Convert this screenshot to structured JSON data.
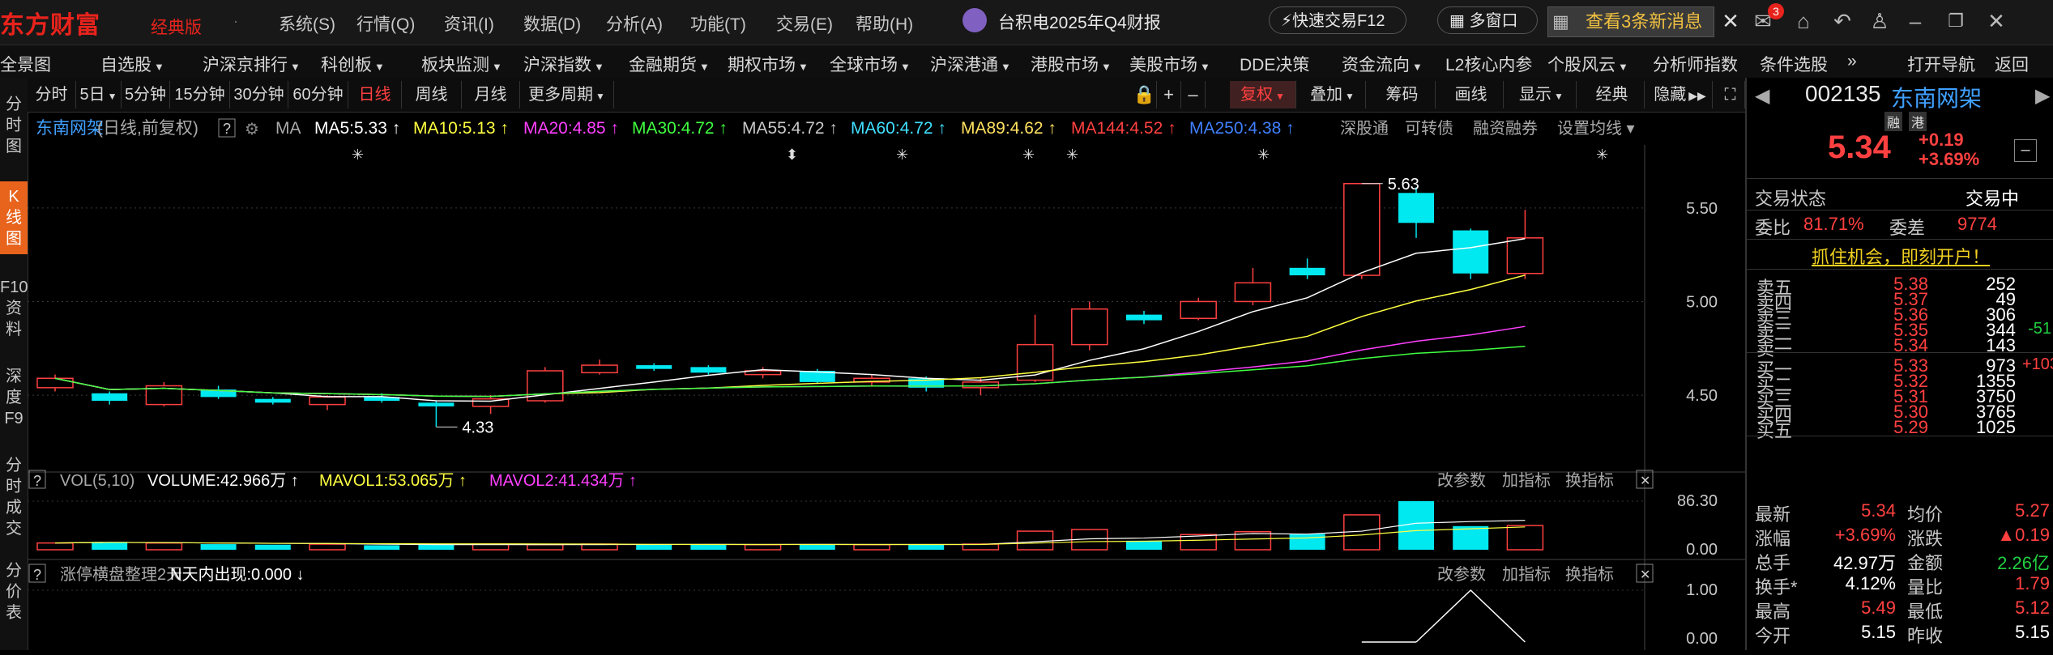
{
  "app": {
    "logo": "东方财富",
    "logo_sub": "经典版",
    "menus": [
      "系统(S)",
      "行情(Q)",
      "资讯(I)",
      "数据(D)",
      "分析(A)",
      "功能(T)",
      "交易(E)",
      "帮助(H)"
    ],
    "notice": "台积电2025年Q4财报",
    "quick_trade": "快速交易F12",
    "multi_window": "多窗口",
    "news_btn": "查看3条新消息",
    "mail_badge": "3"
  },
  "nav": {
    "items": [
      {
        "label": "全景图",
        "dd": false
      },
      {
        "label": "自选股",
        "dd": true
      },
      {
        "label": "沪深京排行",
        "dd": true
      },
      {
        "label": "科创板",
        "dd": true
      },
      {
        "label": "板块监测",
        "dd": true
      },
      {
        "label": "沪深指数",
        "dd": true
      },
      {
        "label": "金融期货",
        "dd": true
      },
      {
        "label": "期权市场",
        "dd": true
      },
      {
        "label": "全球市场",
        "dd": true
      },
      {
        "label": "沪深港通",
        "dd": true
      },
      {
        "label": "港股市场",
        "dd": true
      },
      {
        "label": "美股市场",
        "dd": true
      },
      {
        "label": "DDE决策",
        "dd": false
      },
      {
        "label": "资金流向",
        "dd": true
      },
      {
        "label": "L2核心内参",
        "dd": false
      },
      {
        "label": "个股风云",
        "dd": true
      },
      {
        "label": "分析师指数",
        "dd": false
      },
      {
        "label": "条件选股",
        "dd": false
      }
    ],
    "more": "»",
    "open_nav": "打开导航",
    "back": "返回"
  },
  "leftbar": {
    "items": [
      "分时图",
      "K线图",
      "F10资料",
      "深度F9",
      "分时成交",
      "分价表"
    ]
  },
  "toolbar": {
    "periods": [
      "分时",
      "5日",
      "5分钟",
      "15分钟",
      "30分钟",
      "60分钟",
      "日线",
      "周线",
      "月线",
      "更多周期"
    ],
    "active": "日线",
    "right": [
      "复权",
      "叠加",
      "筹码",
      "画线",
      "显示",
      "经典",
      "隐藏"
    ]
  },
  "chart_header": {
    "stock": "东南网架",
    "mode": "(日线,前复权)",
    "help": "?",
    "ma_label": "MA",
    "ma": [
      {
        "text": "MA5:5.33",
        "color": "#ffffff"
      },
      {
        "text": "MA10:5.13",
        "color": "#ffff40"
      },
      {
        "text": "MA20:4.85",
        "color": "#ff40ff"
      },
      {
        "text": "MA30:4.72",
        "color": "#40ff40"
      },
      {
        "text": "MA55:4.72",
        "color": "#c8c8c8"
      },
      {
        "text": "MA60:4.72",
        "color": "#40e0ff"
      },
      {
        "text": "MA89:4.62",
        "color": "#ffe060"
      },
      {
        "text": "MA144:4.52",
        "color": "#ff4040"
      },
      {
        "text": "MA250:4.38",
        "color": "#4080ff"
      }
    ],
    "links": [
      "深股通",
      "可转债",
      "融资融券",
      "设置均线"
    ]
  },
  "volume_header": {
    "help": "?",
    "name": "VOL(5,10)",
    "volume": "VOLUME:42.966万",
    "mavol1": "MAVOL1:53.065万",
    "mavol2": "MAVOL2:41.434万",
    "links": [
      "改参数",
      "加指标",
      "换指标"
    ]
  },
  "indicator_header": {
    "help": "?",
    "name": "涨停横盘整理2天",
    "value": "N天内出现:0.000",
    "links": [
      "改参数",
      "加指标",
      "换指标"
    ]
  },
  "chart_data": {
    "type": "candlestick",
    "y_ticks": [
      "5.50",
      "5.00",
      "4.50"
    ],
    "ylim": [
      4.15,
      5.75
    ],
    "max_label": "5.63",
    "min_label": "4.33",
    "candles": [
      {
        "o": 4.54,
        "c": 4.59,
        "h": 4.61,
        "l": 4.52
      },
      {
        "o": 4.51,
        "c": 4.47,
        "h": 4.52,
        "l": 4.45
      },
      {
        "o": 4.45,
        "c": 4.55,
        "h": 4.57,
        "l": 4.44
      },
      {
        "o": 4.53,
        "c": 4.49,
        "h": 4.55,
        "l": 4.48
      },
      {
        "o": 4.48,
        "c": 4.46,
        "h": 4.49,
        "l": 4.45
      },
      {
        "o": 4.45,
        "c": 4.49,
        "h": 4.5,
        "l": 4.42
      },
      {
        "o": 4.49,
        "c": 4.47,
        "h": 4.51,
        "l": 4.46
      },
      {
        "o": 4.46,
        "c": 4.44,
        "h": 4.47,
        "l": 4.33
      },
      {
        "o": 4.44,
        "c": 4.48,
        "h": 4.5,
        "l": 4.4
      },
      {
        "o": 4.47,
        "c": 4.63,
        "h": 4.65,
        "l": 4.46
      },
      {
        "o": 4.62,
        "c": 4.66,
        "h": 4.69,
        "l": 4.61
      },
      {
        "o": 4.66,
        "c": 4.64,
        "h": 4.67,
        "l": 4.63
      },
      {
        "o": 4.65,
        "c": 4.62,
        "h": 4.66,
        "l": 4.61
      },
      {
        "o": 4.61,
        "c": 4.63,
        "h": 4.65,
        "l": 4.59
      },
      {
        "o": 4.63,
        "c": 4.57,
        "h": 4.64,
        "l": 4.56
      },
      {
        "o": 4.57,
        "c": 4.59,
        "h": 4.61,
        "l": 4.55
      },
      {
        "o": 4.59,
        "c": 4.54,
        "h": 4.6,
        "l": 4.52
      },
      {
        "o": 4.54,
        "c": 4.57,
        "h": 4.59,
        "l": 4.5
      },
      {
        "o": 4.58,
        "c": 4.77,
        "h": 4.93,
        "l": 4.57
      },
      {
        "o": 4.77,
        "c": 4.96,
        "h": 5.0,
        "l": 4.74
      },
      {
        "o": 4.93,
        "c": 4.9,
        "h": 4.95,
        "l": 4.88
      },
      {
        "o": 4.91,
        "c": 5.0,
        "h": 5.02,
        "l": 4.9
      },
      {
        "o": 5.0,
        "c": 5.1,
        "h": 5.18,
        "l": 4.98
      },
      {
        "o": 5.18,
        "c": 5.14,
        "h": 5.23,
        "l": 5.12
      },
      {
        "o": 5.14,
        "c": 5.63,
        "h": 5.63,
        "l": 5.12
      },
      {
        "o": 5.58,
        "c": 5.42,
        "h": 5.61,
        "l": 5.34
      },
      {
        "o": 5.38,
        "c": 5.15,
        "h": 5.39,
        "l": 5.12
      },
      {
        "o": 5.15,
        "c": 5.34,
        "h": 5.49,
        "l": 5.12
      }
    ],
    "volume": {
      "y_ticks": [
        "86.30",
        "0.00"
      ],
      "ymax": 86.3,
      "values": [
        12,
        14,
        12,
        10,
        9,
        10,
        8,
        9,
        10,
        9,
        10,
        9,
        10,
        9,
        10,
        9,
        9,
        10,
        33,
        36,
        16,
        27,
        32,
        28,
        62,
        86.3,
        42,
        43
      ]
    },
    "indicator": {
      "y_ticks": [
        "1.00",
        "0.00"
      ]
    }
  },
  "quote": {
    "code": "002135",
    "name": "东南网架",
    "price": "5.34",
    "change": "+0.19",
    "pct": "+3.69%",
    "tag1": "融",
    "tag2": "港",
    "trade_state_label": "交易状态",
    "trade_state": "交易中",
    "webi_label": "委比",
    "webi": "81.71%",
    "weicha_label": "委差",
    "weicha": "9774",
    "promo": "抓住机会，即刻开户！",
    "asks": [
      {
        "label": "卖五",
        "price": "5.38",
        "vol": "252",
        "chg": ""
      },
      {
        "label": "卖四",
        "price": "5.37",
        "vol": "49",
        "chg": ""
      },
      {
        "label": "卖三",
        "price": "5.36",
        "vol": "306",
        "chg": ""
      },
      {
        "label": "卖二",
        "price": "5.35",
        "vol": "344",
        "chg": "-51"
      },
      {
        "label": "卖一",
        "price": "5.34",
        "vol": "143",
        "chg": ""
      }
    ],
    "bids": [
      {
        "label": "买一",
        "price": "5.33",
        "vol": "973",
        "chg": "+103"
      },
      {
        "label": "买二",
        "price": "5.32",
        "vol": "1355",
        "chg": ""
      },
      {
        "label": "买三",
        "price": "5.31",
        "vol": "3750",
        "chg": ""
      },
      {
        "label": "买四",
        "price": "5.30",
        "vol": "3765",
        "chg": ""
      },
      {
        "label": "买五",
        "price": "5.29",
        "vol": "1025",
        "chg": ""
      }
    ],
    "stats": [
      [
        {
          "label": "最新",
          "val": "5.34",
          "cls": "red"
        },
        {
          "label": "均价",
          "val": "5.27",
          "cls": "red"
        }
      ],
      [
        {
          "label": "涨幅",
          "val": "+3.69%",
          "cls": "red"
        },
        {
          "label": "涨跌",
          "val": "▲0.19",
          "cls": "red"
        }
      ],
      [
        {
          "label": "总手",
          "val": "42.97万",
          "cls": "white"
        },
        {
          "label": "金额",
          "val": "2.26亿",
          "cls": "green"
        }
      ],
      [
        {
          "label": "换手*",
          "val": "4.12%",
          "cls": "white"
        },
        {
          "label": "量比",
          "val": "1.79",
          "cls": "red"
        }
      ],
      [
        {
          "label": "最高",
          "val": "5.49",
          "cls": "red"
        },
        {
          "label": "最低",
          "val": "5.12",
          "cls": "red"
        }
      ],
      [
        {
          "label": "今开",
          "val": "5.15",
          "cls": "white"
        },
        {
          "label": "昨收",
          "val": "5.15",
          "cls": "white"
        }
      ]
    ]
  },
  "colors": {
    "up": "#ff4040",
    "down": "#00e8f0",
    "bg": "#000000",
    "grid": "#2a2a2a",
    "accent": "#e8631c"
  }
}
